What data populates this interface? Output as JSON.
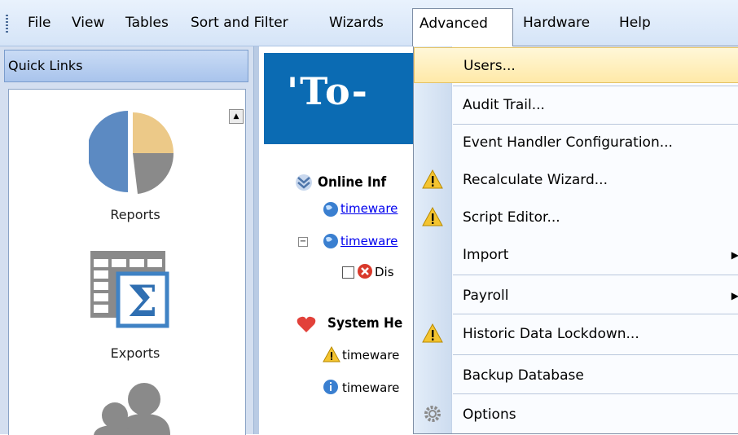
{
  "menubar": {
    "items": [
      "File",
      "View",
      "Tables",
      "Sort and Filter",
      "Wizards",
      "Advanced",
      "Hardware",
      "Help"
    ]
  },
  "quick_links": {
    "title": "Quick Links",
    "items": [
      "Reports",
      "Exports"
    ]
  },
  "main": {
    "banner": "'To-",
    "online_heading": "Online Inf",
    "online_links": [
      "timeware",
      "timeware"
    ],
    "online_sub": "Dis",
    "system_heading": "System He",
    "system_items": [
      "timeware",
      "timeware"
    ]
  },
  "dropdown": {
    "items": [
      {
        "label": "Users...",
        "icon": "none"
      },
      {
        "label": "Audit Trail...",
        "icon": "none"
      },
      {
        "label": "Event Handler Configuration...",
        "icon": "none"
      },
      {
        "label": "Recalculate Wizard...",
        "icon": "warning-icon"
      },
      {
        "label": "Script Editor...",
        "icon": "warning-icon"
      },
      {
        "label": "Import",
        "icon": "none",
        "submenu": true
      },
      {
        "label": "Payroll",
        "icon": "none",
        "submenu": true
      },
      {
        "label": "Historic Data Lockdown...",
        "icon": "warning-icon"
      },
      {
        "label": "Backup Database",
        "icon": "none"
      },
      {
        "label": "Options",
        "icon": "gear-icon"
      }
    ],
    "submenu_arrow": "▶",
    "highlighted": "Users..."
  },
  "colors": {
    "banner": "#0b6bb3",
    "highlight": "#ffe9a8"
  }
}
